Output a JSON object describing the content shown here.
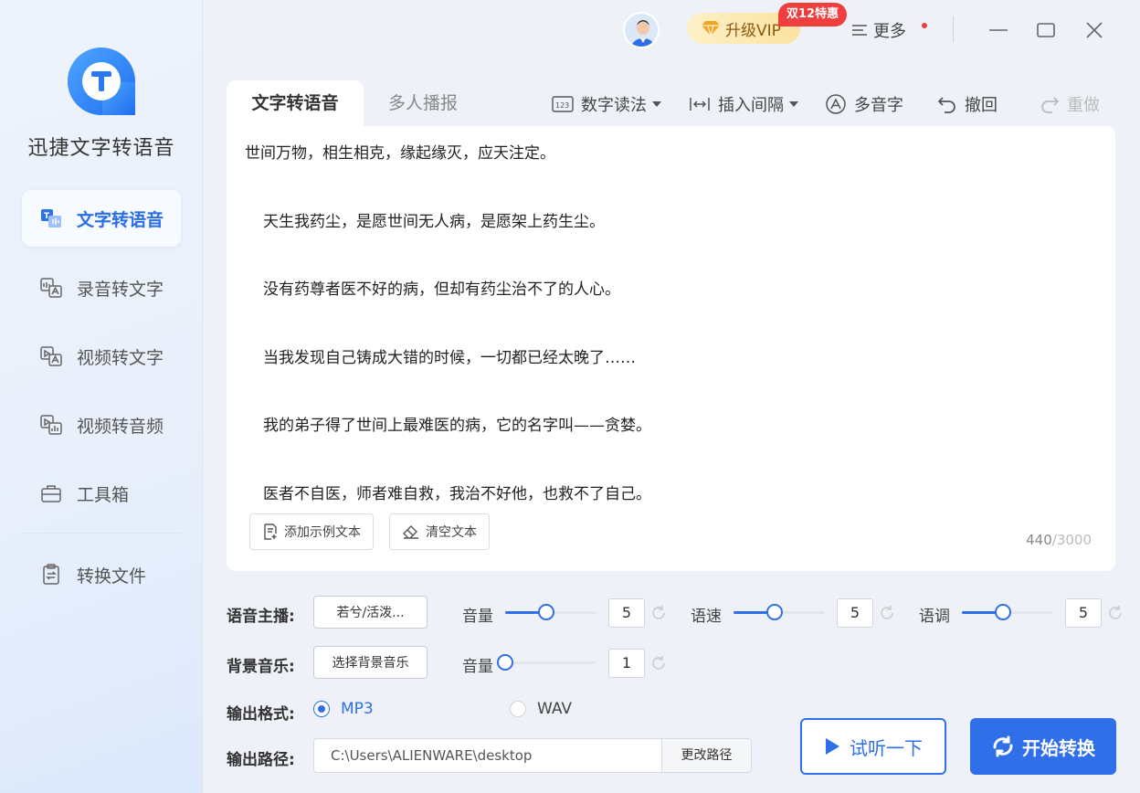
{
  "app": {
    "name": "迅捷文字转语音"
  },
  "sidebar": {
    "items": [
      {
        "label": "文字转语音",
        "icon": "text-to-speech-icon",
        "active": true
      },
      {
        "label": "录音转文字",
        "icon": "audio-to-text-icon"
      },
      {
        "label": "视频转文字",
        "icon": "video-to-text-icon"
      },
      {
        "label": "视频转音频",
        "icon": "video-to-audio-icon"
      },
      {
        "label": "工具箱",
        "icon": "toolbox-icon"
      },
      {
        "label": "转换文件",
        "icon": "converted-files-icon"
      }
    ]
  },
  "topbar": {
    "vip_label": "升级VIP",
    "vip_badge": "双12特惠",
    "more_label": "更多"
  },
  "tabs": [
    {
      "label": "文字转语音",
      "active": true
    },
    {
      "label": "多人播报"
    }
  ],
  "toolbar": {
    "number_reading": "数字读法",
    "insert_pause": "插入间隔",
    "polyphone": "多音字",
    "undo": "撤回",
    "redo": "重做"
  },
  "editor": {
    "lines": [
      "世间万物，相生相克，缘起缘灭，应天注定。",
      "天生我药尘，是愿世间无人病，是愿架上药生尘。",
      "没有药尊者医不好的病，但却有药尘治不了的人心。",
      "当我发现自己铸成大错的时候，一切都已经太晚了……",
      "我的弟子得了世间上最难医的病，它的名字叫——贪婪。",
      "医者不自医，师者难自救，我治不好他，也救不了自己。"
    ],
    "add_sample_label": "添加示例文本",
    "clear_label": "清空文本",
    "char_count": "440",
    "char_max": "/3000"
  },
  "controls": {
    "voice_label": "语音主播:",
    "voice_value": "若兮/活泼...",
    "volume_label": "音量",
    "volume_value": "5",
    "speed_label": "语速",
    "speed_value": "5",
    "pitch_label": "语调",
    "pitch_value": "5",
    "bgm_label": "背景音乐:",
    "bgm_button": "选择背景音乐",
    "bgm_volume_label": "音量",
    "bgm_volume_value": "1",
    "format_label": "输出格式:",
    "format_mp3": "MP3",
    "format_wav": "WAV",
    "format_selected": "MP3",
    "path_label": "输出路径:",
    "path_value": "C:\\Users\\ALIENWARE\\desktop",
    "change_path": "更改路径",
    "preview_label": "试听一下",
    "start_label": "开始转换"
  },
  "slider_levels": {
    "volume": 0.45,
    "speed": 0.45,
    "pitch": 0.45,
    "bgm_volume": 0.0
  },
  "colors": {
    "accent": "#2f6fea",
    "vip_badge": "#f03d3d",
    "vip_bg": "#fbe3a0"
  }
}
